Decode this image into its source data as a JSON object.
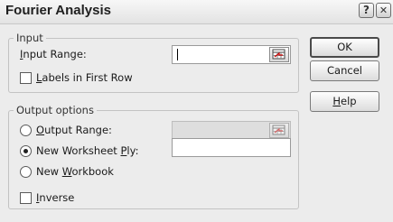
{
  "dialog": {
    "title": "Fourier Analysis",
    "help_glyph": "?",
    "close_glyph": "✕"
  },
  "input_group": {
    "legend": "Input",
    "input_range": {
      "label_before": "",
      "mnemonic": "I",
      "label_after": "nput Range:",
      "value": ""
    },
    "labels_first_row": {
      "label_before": "",
      "mnemonic": "L",
      "label_after": "abels in First Row",
      "checked": false
    }
  },
  "output_group": {
    "legend": "Output options",
    "output_range": {
      "label_before": "",
      "mnemonic": "O",
      "label_after": "utput Range:",
      "selected": false
    },
    "new_worksheet": {
      "label_before": "New Worksheet ",
      "mnemonic": "P",
      "label_after": "ly:",
      "selected": true
    },
    "new_workbook": {
      "label_before": "New ",
      "mnemonic": "W",
      "label_after": "orkbook",
      "selected": false
    },
    "inverse": {
      "label_before": "",
      "mnemonic": "I",
      "label_after": "nverse",
      "checked": false
    }
  },
  "buttons": {
    "ok": "OK",
    "cancel": "Cancel",
    "help_before": "",
    "help_mnemonic": "H",
    "help_after": "elp"
  }
}
